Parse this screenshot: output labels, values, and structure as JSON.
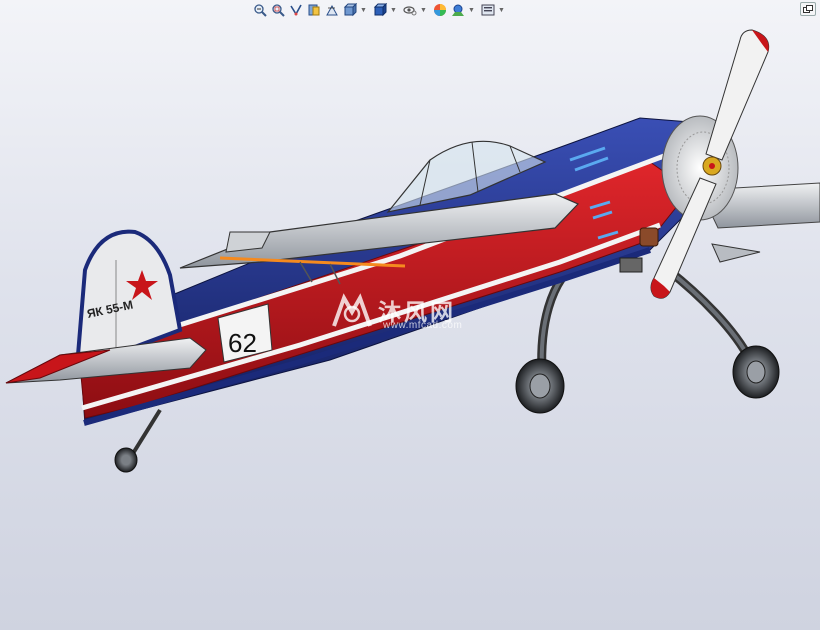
{
  "toolbar": {
    "buttons": [
      {
        "name": "zoom-to-fit-icon"
      },
      {
        "name": "zoom-to-area-icon"
      },
      {
        "name": "previous-view-icon"
      },
      {
        "name": "section-view-icon"
      },
      {
        "name": "dynamic-annotation-icon"
      },
      {
        "name": "view-orientation-icon",
        "dropdown": true
      },
      {
        "name": "display-style-icon",
        "dropdown": true
      },
      {
        "name": "hide-show-items-icon",
        "dropdown": true
      },
      {
        "name": "edit-appearance-icon"
      },
      {
        "name": "apply-scene-icon",
        "dropdown": true
      },
      {
        "name": "view-settings-icon",
        "dropdown": true
      }
    ]
  },
  "model": {
    "fuselage_text": "ЯК 55-М",
    "race_number": "62",
    "colors": {
      "blue": "#1b2a7a",
      "red": "#c8151a",
      "white": "#f4f4f4",
      "gray": "#9aa0a8"
    }
  },
  "watermark": {
    "text": "沐风网",
    "url": "www.mfcad.com"
  }
}
